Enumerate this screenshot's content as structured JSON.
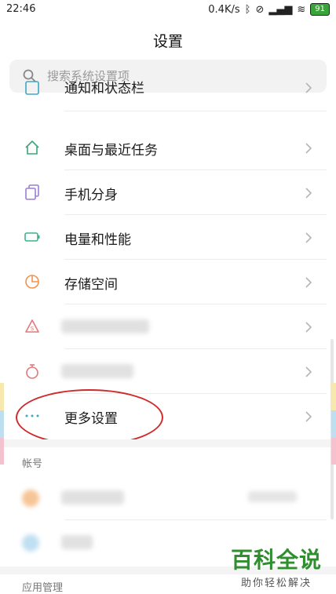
{
  "status_bar": {
    "time": "22:46",
    "net_speed": "0.4K/s",
    "battery": "91"
  },
  "header": {
    "title": "设置"
  },
  "search": {
    "placeholder": "搜索系统设置项"
  },
  "settings": {
    "items": [
      {
        "label": "通知和状态栏",
        "icon": "notification-icon",
        "color": "#3fa6c7"
      },
      {
        "label": "桌面与最近任务",
        "icon": "home-icon",
        "color": "#3aa77a"
      },
      {
        "label": "手机分身",
        "icon": "dual-phone-icon",
        "color": "#9a7fd6"
      },
      {
        "label": "电量和性能",
        "icon": "battery-icon",
        "color": "#3ab58a"
      },
      {
        "label": "存储空间",
        "icon": "storage-pie-icon",
        "color": "#f0934b"
      },
      {
        "label": "",
        "icon": "security-shield-icon",
        "color": "#e07a7a"
      },
      {
        "label": "",
        "icon": "stopwatch-icon",
        "color": "#e07a7a"
      },
      {
        "label": "更多设置",
        "icon": "more-dots-icon",
        "color": "#3fa6c7"
      }
    ]
  },
  "sections": {
    "account": "帐号",
    "app_management": "应用管理"
  },
  "watermark": {
    "big": "百科全说",
    "small": "助你轻松解决"
  }
}
